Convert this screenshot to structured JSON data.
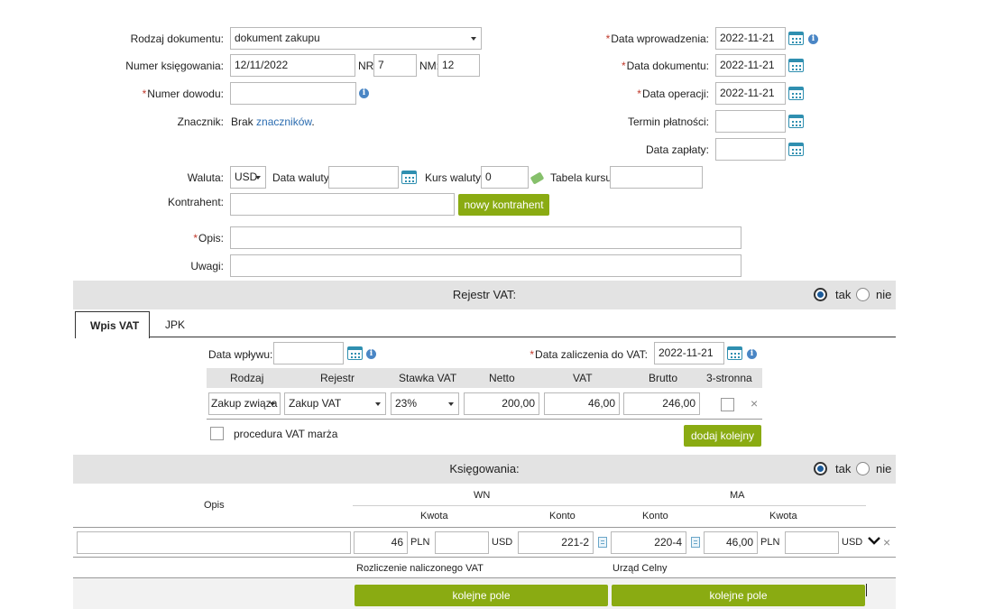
{
  "form": {
    "doc_type_label": "Rodzaj dokumentu:",
    "doc_type_value": "dokument zakupu",
    "booking_number_label": "Numer księgowania:",
    "booking_number_value": "12/11/2022",
    "nr_label": "NR:",
    "nr_value": "7",
    "nm_label": "NM:",
    "nm_value": "12",
    "proof_number_label": "Numer dowodu:",
    "proof_number_value": "",
    "tag_label": "Znacznik:",
    "tag_text": "Brak",
    "tag_link": "znaczników",
    "tag_dot": ".",
    "entry_date_label": "Data wprowadzenia:",
    "entry_date_value": "2022-11-21",
    "doc_date_label": "Data dokumentu:",
    "doc_date_value": "2022-11-21",
    "operation_date_label": "Data operacji:",
    "operation_date_value": "2022-11-21",
    "payment_term_label": "Termin płatności:",
    "payment_term_value": "",
    "payment_date_label": "Data zapłaty:",
    "payment_date_value": "",
    "currency_label": "Waluta:",
    "currency_value": "USD",
    "currency_date_label": "Data waluty:",
    "currency_date_value": "",
    "rate_label": "Kurs waluty:",
    "rate_value": "0",
    "rate_table_label": "Tabela kursu:",
    "rate_table_value": "",
    "contractor_label": "Kontrahent:",
    "contractor_value": "",
    "new_contractor_button": "nowy kontrahent",
    "description_label": "Opis:",
    "description_value": "",
    "notes_label": "Uwagi:",
    "notes_value": "",
    "required_mark": "*"
  },
  "vat_section": {
    "title": "Rejestr VAT:",
    "yes": "tak",
    "no": "nie",
    "selected": "tak"
  },
  "tabs": [
    {
      "label": "Wpis VAT",
      "active": true
    },
    {
      "label": "JPK",
      "active": false
    }
  ],
  "vat_entry": {
    "receipt_date_label": "Data wpływu:",
    "receipt_date_value": "",
    "vat_inclusion_date_label": "Data zaliczenia do VAT:",
    "vat_inclusion_date_value": "2022-11-21",
    "columns": [
      "Rodzaj",
      "Rejestr",
      "Stawka VAT",
      "Netto",
      "VAT",
      "Brutto",
      "3-stronna"
    ],
    "row": {
      "type": "Zakup związa",
      "register": "Zakup VAT",
      "rate": "23%",
      "net": "200,00",
      "vat": "46,00",
      "gross": "246,00",
      "tripartite": false
    },
    "margin_procedure_label": "procedura VAT marża",
    "add_next_button": "dodaj kolejny"
  },
  "bookings_section": {
    "title": "Księgowania:",
    "yes": "tak",
    "no": "nie",
    "selected": "tak"
  },
  "bookings": {
    "opis_header": "Opis",
    "wn_header": "WN",
    "ma_header": "MA",
    "kwota_wn": "Kwota",
    "konto_wn": "Konto",
    "konto_ma": "Konto",
    "kwota_ma": "Kwota",
    "row": {
      "description": "",
      "wn_amount": "46",
      "wn_currency1": "PLN",
      "wn_foreign": "",
      "wn_currency2": "USD",
      "wn_account": "221-2",
      "ma_account": "220-4",
      "ma_amount": "46,00",
      "ma_currency1": "PLN",
      "ma_foreign": "",
      "ma_currency2": "USD"
    },
    "wn_account_name": "Rozliczenie naliczonego VAT",
    "ma_account_name": "Urząd Celny",
    "next_field_button_wn": "kolejne pole",
    "next_field_button_ma": "kolejne pole"
  },
  "icons": {
    "close": "×",
    "chevron": "⌄",
    "info": "i"
  }
}
